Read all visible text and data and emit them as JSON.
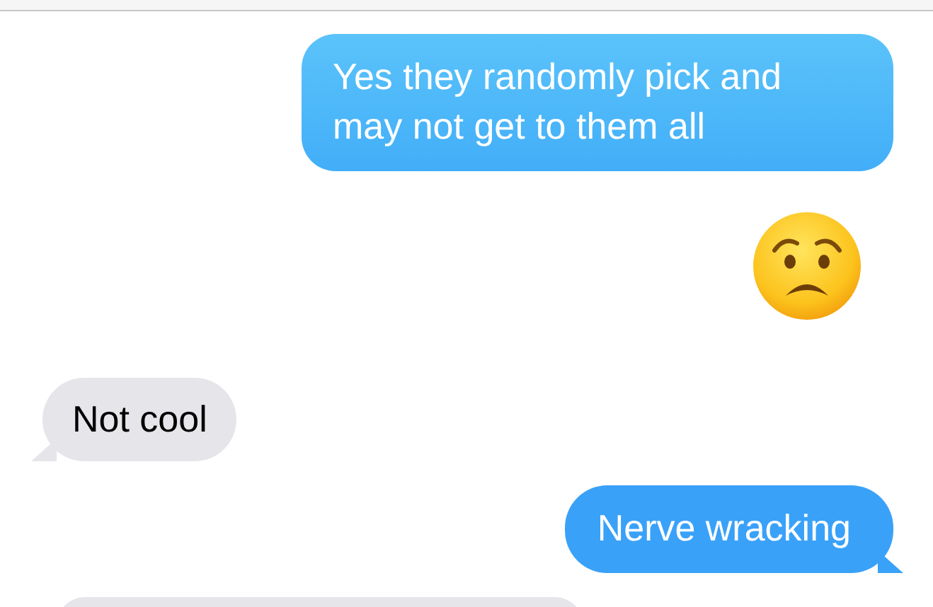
{
  "messages": [
    {
      "kind": "outgoing",
      "text": "Yes they randomly pick and may not get to them all",
      "tail": false
    },
    {
      "kind": "emoji"
    },
    {
      "kind": "incoming",
      "text": "Not cool",
      "tail": true
    },
    {
      "kind": "outgoing",
      "text": "Nerve wracking",
      "tail": true
    },
    {
      "kind": "incoming"
    }
  ]
}
